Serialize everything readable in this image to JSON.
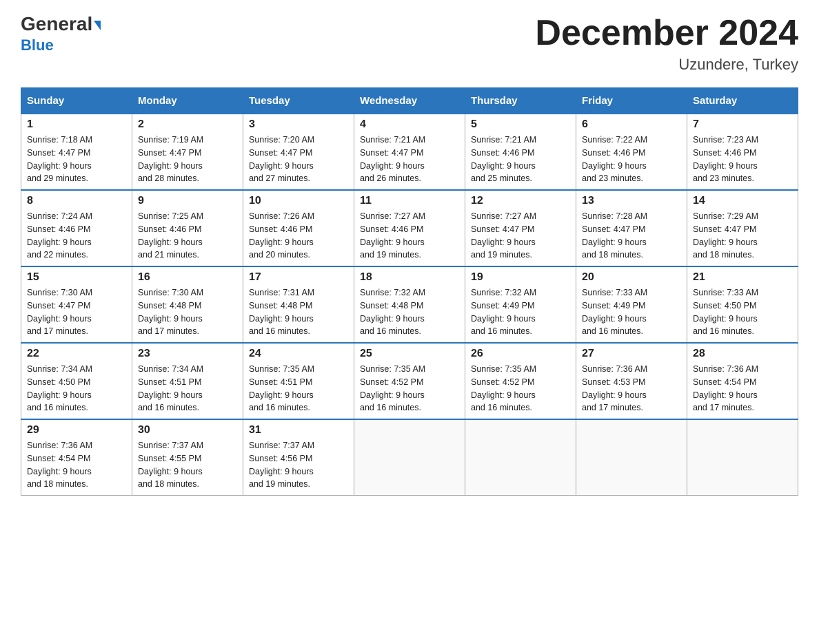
{
  "header": {
    "logo_line1": "General",
    "logo_line2": "Blue",
    "month_title": "December 2024",
    "location": "Uzundere, Turkey"
  },
  "weekdays": [
    "Sunday",
    "Monday",
    "Tuesday",
    "Wednesday",
    "Thursday",
    "Friday",
    "Saturday"
  ],
  "weeks": [
    [
      {
        "day": "1",
        "sunrise": "7:18 AM",
        "sunset": "4:47 PM",
        "daylight": "9 hours and 29 minutes."
      },
      {
        "day": "2",
        "sunrise": "7:19 AM",
        "sunset": "4:47 PM",
        "daylight": "9 hours and 28 minutes."
      },
      {
        "day": "3",
        "sunrise": "7:20 AM",
        "sunset": "4:47 PM",
        "daylight": "9 hours and 27 minutes."
      },
      {
        "day": "4",
        "sunrise": "7:21 AM",
        "sunset": "4:47 PM",
        "daylight": "9 hours and 26 minutes."
      },
      {
        "day": "5",
        "sunrise": "7:21 AM",
        "sunset": "4:46 PM",
        "daylight": "9 hours and 25 minutes."
      },
      {
        "day": "6",
        "sunrise": "7:22 AM",
        "sunset": "4:46 PM",
        "daylight": "9 hours and 23 minutes."
      },
      {
        "day": "7",
        "sunrise": "7:23 AM",
        "sunset": "4:46 PM",
        "daylight": "9 hours and 23 minutes."
      }
    ],
    [
      {
        "day": "8",
        "sunrise": "7:24 AM",
        "sunset": "4:46 PM",
        "daylight": "9 hours and 22 minutes."
      },
      {
        "day": "9",
        "sunrise": "7:25 AM",
        "sunset": "4:46 PM",
        "daylight": "9 hours and 21 minutes."
      },
      {
        "day": "10",
        "sunrise": "7:26 AM",
        "sunset": "4:46 PM",
        "daylight": "9 hours and 20 minutes."
      },
      {
        "day": "11",
        "sunrise": "7:27 AM",
        "sunset": "4:46 PM",
        "daylight": "9 hours and 19 minutes."
      },
      {
        "day": "12",
        "sunrise": "7:27 AM",
        "sunset": "4:47 PM",
        "daylight": "9 hours and 19 minutes."
      },
      {
        "day": "13",
        "sunrise": "7:28 AM",
        "sunset": "4:47 PM",
        "daylight": "9 hours and 18 minutes."
      },
      {
        "day": "14",
        "sunrise": "7:29 AM",
        "sunset": "4:47 PM",
        "daylight": "9 hours and 18 minutes."
      }
    ],
    [
      {
        "day": "15",
        "sunrise": "7:30 AM",
        "sunset": "4:47 PM",
        "daylight": "9 hours and 17 minutes."
      },
      {
        "day": "16",
        "sunrise": "7:30 AM",
        "sunset": "4:48 PM",
        "daylight": "9 hours and 17 minutes."
      },
      {
        "day": "17",
        "sunrise": "7:31 AM",
        "sunset": "4:48 PM",
        "daylight": "9 hours and 16 minutes."
      },
      {
        "day": "18",
        "sunrise": "7:32 AM",
        "sunset": "4:48 PM",
        "daylight": "9 hours and 16 minutes."
      },
      {
        "day": "19",
        "sunrise": "7:32 AM",
        "sunset": "4:49 PM",
        "daylight": "9 hours and 16 minutes."
      },
      {
        "day": "20",
        "sunrise": "7:33 AM",
        "sunset": "4:49 PM",
        "daylight": "9 hours and 16 minutes."
      },
      {
        "day": "21",
        "sunrise": "7:33 AM",
        "sunset": "4:50 PM",
        "daylight": "9 hours and 16 minutes."
      }
    ],
    [
      {
        "day": "22",
        "sunrise": "7:34 AM",
        "sunset": "4:50 PM",
        "daylight": "9 hours and 16 minutes."
      },
      {
        "day": "23",
        "sunrise": "7:34 AM",
        "sunset": "4:51 PM",
        "daylight": "9 hours and 16 minutes."
      },
      {
        "day": "24",
        "sunrise": "7:35 AM",
        "sunset": "4:51 PM",
        "daylight": "9 hours and 16 minutes."
      },
      {
        "day": "25",
        "sunrise": "7:35 AM",
        "sunset": "4:52 PM",
        "daylight": "9 hours and 16 minutes."
      },
      {
        "day": "26",
        "sunrise": "7:35 AM",
        "sunset": "4:52 PM",
        "daylight": "9 hours and 16 minutes."
      },
      {
        "day": "27",
        "sunrise": "7:36 AM",
        "sunset": "4:53 PM",
        "daylight": "9 hours and 17 minutes."
      },
      {
        "day": "28",
        "sunrise": "7:36 AM",
        "sunset": "4:54 PM",
        "daylight": "9 hours and 17 minutes."
      }
    ],
    [
      {
        "day": "29",
        "sunrise": "7:36 AM",
        "sunset": "4:54 PM",
        "daylight": "9 hours and 18 minutes."
      },
      {
        "day": "30",
        "sunrise": "7:37 AM",
        "sunset": "4:55 PM",
        "daylight": "9 hours and 18 minutes."
      },
      {
        "day": "31",
        "sunrise": "7:37 AM",
        "sunset": "4:56 PM",
        "daylight": "9 hours and 19 minutes."
      },
      null,
      null,
      null,
      null
    ]
  ],
  "labels": {
    "sunrise_prefix": "Sunrise: ",
    "sunset_prefix": "Sunset: ",
    "daylight_prefix": "Daylight: "
  }
}
